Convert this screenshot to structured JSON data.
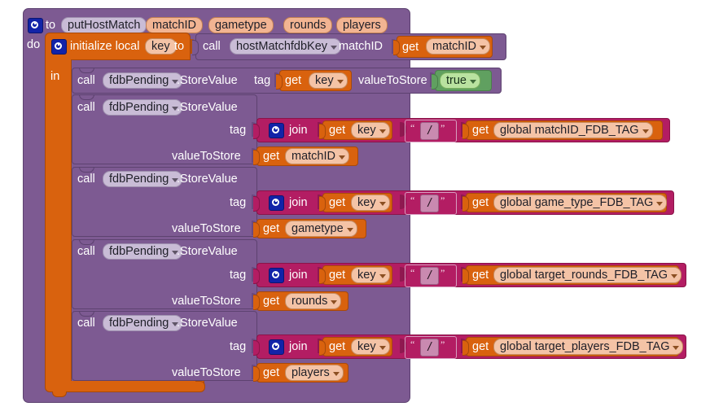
{
  "app": "MIT App Inventor Blocks Editor",
  "procedure": {
    "kind": "to",
    "keyword_to": "to",
    "name": "putHostMatch",
    "params": [
      "matchID",
      "gametype",
      "rounds",
      "players"
    ],
    "do_label": "do",
    "mutator_icon": "gear-icon"
  },
  "local": {
    "keyword": "initialize local",
    "var_name": "key",
    "keyword_to": "to",
    "in_label": "in",
    "mutator_icon": "gear-icon",
    "value_call": {
      "call_label": "call",
      "procedure": "hostMatchfdbKey",
      "arg_label": "matchID",
      "arg_get": {
        "get_label": "get",
        "variable": "matchID"
      }
    }
  },
  "store_calls": [
    {
      "call_label": "call",
      "component": "fdbPending",
      "method": ".StoreValue",
      "inline": true,
      "tag_label": "tag",
      "tag_get": {
        "get_label": "get",
        "variable": "key"
      },
      "value_label": "valueToStore",
      "value_logic": "true"
    },
    {
      "call_label": "call",
      "component": "fdbPending",
      "method": ".StoreValue",
      "inline": false,
      "tag_label": "tag",
      "join": {
        "join_label": "join",
        "mutator_icon": "gear-icon",
        "arg1": {
          "get_label": "get",
          "variable": "key"
        },
        "text": "/",
        "arg2": {
          "get_label": "get",
          "variable": "global matchID_FDB_TAG"
        }
      },
      "value_label": "valueToStore",
      "value_get": {
        "get_label": "get",
        "variable": "matchID"
      }
    },
    {
      "call_label": "call",
      "component": "fdbPending",
      "method": ".StoreValue",
      "inline": false,
      "tag_label": "tag",
      "join": {
        "join_label": "join",
        "mutator_icon": "gear-icon",
        "arg1": {
          "get_label": "get",
          "variable": "key"
        },
        "text": "/",
        "arg2": {
          "get_label": "get",
          "variable": "global game_type_FDB_TAG"
        }
      },
      "value_label": "valueToStore",
      "value_get": {
        "get_label": "get",
        "variable": "gametype"
      }
    },
    {
      "call_label": "call",
      "component": "fdbPending",
      "method": ".StoreValue",
      "inline": false,
      "tag_label": "tag",
      "join": {
        "join_label": "join",
        "mutator_icon": "gear-icon",
        "arg1": {
          "get_label": "get",
          "variable": "key"
        },
        "text": "/",
        "arg2": {
          "get_label": "get",
          "variable": "global target_rounds_FDB_TAG"
        }
      },
      "value_label": "valueToStore",
      "value_get": {
        "get_label": "get",
        "variable": "rounds"
      }
    },
    {
      "call_label": "call",
      "component": "fdbPending",
      "method": ".StoreValue",
      "inline": false,
      "tag_label": "tag",
      "join": {
        "join_label": "join",
        "mutator_icon": "gear-icon",
        "arg1": {
          "get_label": "get",
          "variable": "key"
        },
        "text": "/",
        "arg2": {
          "get_label": "get",
          "variable": "global target_players_FDB_TAG"
        }
      },
      "value_label": "valueToStore",
      "value_get": {
        "get_label": "get",
        "variable": "players"
      }
    }
  ],
  "colors": {
    "procedure_purple": "#7d5a92",
    "variable_orange": "#d9620e",
    "text_magenta": "#b31d63",
    "logic_green": "#60a060",
    "mutator_blue": "#1223a8"
  }
}
